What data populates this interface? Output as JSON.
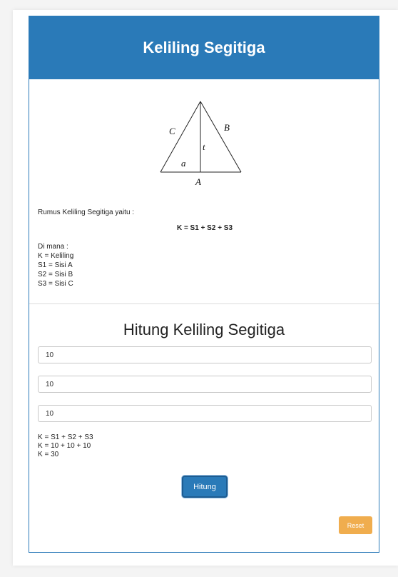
{
  "header": {
    "title": "Keliling Segitiga"
  },
  "diagram": {
    "label_c": "C",
    "label_b": "B",
    "label_t": "t",
    "label_a_small": "a",
    "label_a_big": "A"
  },
  "info": {
    "intro": "Rumus Keliling Segitiga yaitu :",
    "formula": "K = S1 + S2 + S3",
    "where": "Di mana :",
    "definitions": [
      "K = Keliling",
      "S1 = Sisi A",
      "S2 = Sisi B",
      "S3 = Sisi C"
    ]
  },
  "calculator": {
    "title": "Hitung Keliling Segitiga",
    "inputs": [
      "10",
      "10",
      "10"
    ],
    "result_lines": [
      "K = S1 + S2 + S3",
      "K = 10 + 10 + 10",
      "K = 30"
    ],
    "submit_label": "Hitung",
    "reset_label": "Reset"
  }
}
